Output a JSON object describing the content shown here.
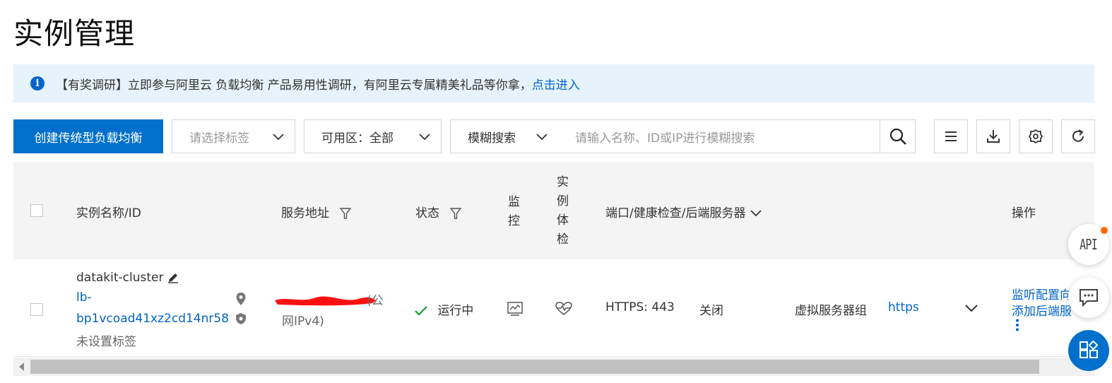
{
  "page": {
    "title": "实例管理"
  },
  "notice": {
    "text": "【有奖调研】立即参与阿里云 负载均衡 产品易用性调研，有阿里云专属精美礼品等你拿，",
    "link": "点击进入",
    "icon": "info-icon"
  },
  "toolbar": {
    "create_label": "创建传统型负载均衡",
    "tag_placeholder": "请选择标签",
    "zone_label": "可用区：",
    "zone_value": "全部",
    "search_mode": "模糊搜索",
    "search_placeholder": "请输入名称、ID或IP进行模糊搜索"
  },
  "table": {
    "headers": {
      "name": "实例名称/ID",
      "address": "服务地址",
      "status": "状态",
      "monitor_1": "监",
      "monitor_2": "控",
      "inspect_1": "实",
      "inspect_2": "例",
      "inspect_3": "体",
      "inspect_4": "检",
      "port": "端口/健康检查/后端服务器",
      "actions": "操作"
    },
    "row": {
      "name": "datakit-cluster",
      "id_line1": "lb-",
      "id_line2": "bp1vcoad41xz2cd14nr58",
      "tag": "未设置标签",
      "address_suffix": "(公",
      "address_type": "网IPv4)",
      "status": "运行中",
      "port": "HTTPS: 443",
      "health": "关闭",
      "backend": "虚拟服务器组",
      "protocol": "https",
      "action_1": "监听配置向",
      "action_2": "添加后端服"
    }
  },
  "floating": {
    "api_label": "API"
  },
  "colors": {
    "primary": "#0070cc",
    "link": "#0064c8",
    "success": "#23a845",
    "notice_bg": "#e6f3fd",
    "redact": "#ff0000"
  }
}
